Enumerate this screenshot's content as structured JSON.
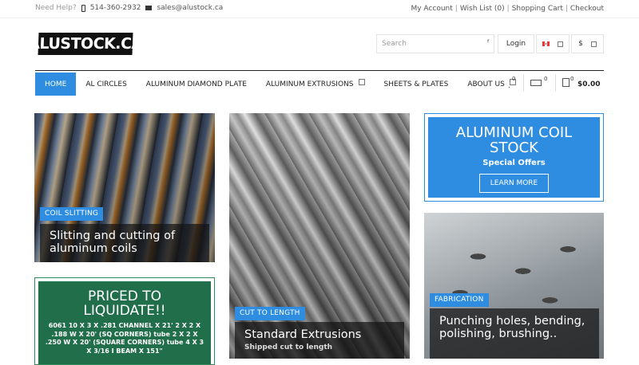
{
  "topbar": {
    "help_label": "Need Help?",
    "phone": "514-360-2932",
    "email": "sales@alustock.ca",
    "links": [
      "My Account",
      "Wish List (0)",
      "Shopping Cart",
      "Checkout"
    ]
  },
  "header": {
    "logo_text": "ALUSTOCK.CA",
    "search_placeholder": "Search",
    "login_label": "Login",
    "currency_symbol": "$"
  },
  "nav": {
    "items": [
      "HOME",
      "AL CIRCLES",
      "ALUMINUM DIAMOND PLATE",
      "ALUMINUM EXTRUSIONS",
      "SHEETS & PLATES",
      "ABOUT US"
    ],
    "wishlist_count": "0",
    "compare_count": "0",
    "cart_count": "0",
    "cart_total": "$0.00"
  },
  "tiles": {
    "coil_slitting": {
      "tag": "COIL SLITTING",
      "caption": "Slitting and cutting of aluminum coils"
    },
    "cut_to_length": {
      "tag": "CUT TO LENGTH",
      "caption": "Standard Extrusions",
      "sub": "Shipped cut to length"
    },
    "fabrication": {
      "tag": "FABRICATION",
      "caption": "Punching holes, bending, polishing, brushing.."
    },
    "coil_stock": {
      "title": "ALUMINUM COIL STOCK",
      "subtitle": "Special Offers",
      "button": "LEARN MORE"
    },
    "liquidate": {
      "title": "PRICED TO LIQUIDATE!!",
      "body": "6061 10 X 3 X .281 CHANNEL X 21' 2 X 2 X .188 W X 20' (SQ CORNERS) tube 2 X 2 X .250 W X 20' (SQUARE CORNERS) tube 4 X 3 X 3/16 I BEAM X 151\""
    }
  },
  "colors": {
    "accent": "#2e8de0",
    "liquidate_green": "#216e4a"
  }
}
